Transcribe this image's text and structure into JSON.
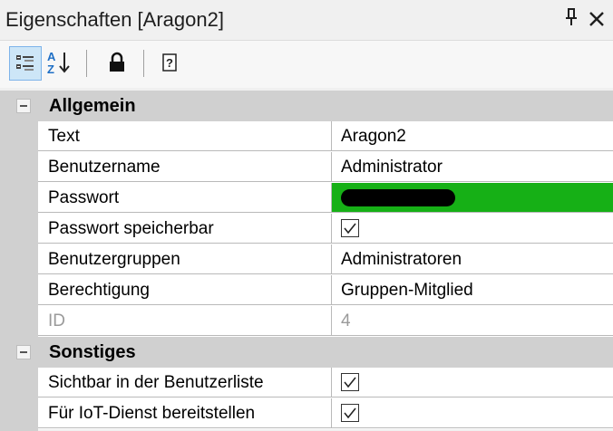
{
  "window": {
    "title": "Eigenschaften [Aragon2]",
    "pin_glyph": "1",
    "close_glyph": "✕"
  },
  "toolbar": {
    "buttons": [
      {
        "name": "categorized",
        "selected": true
      },
      {
        "name": "alphabetical",
        "selected": false
      },
      {
        "name": "lock",
        "selected": false
      },
      {
        "name": "help",
        "selected": false
      }
    ]
  },
  "categories": [
    {
      "label": "Allgemein",
      "properties": [
        {
          "name": "Text",
          "value": "Aragon2"
        },
        {
          "name": "Benutzername",
          "value": "Administrator"
        },
        {
          "name": "Passwort",
          "value": "",
          "masked": true,
          "highlight_color": "#16b016"
        },
        {
          "name": "Passwort speicherbar",
          "value": "",
          "checkbox": true,
          "checked": true
        },
        {
          "name": "Benutzergruppen",
          "value": "Administratoren"
        },
        {
          "name": "Berechtigung",
          "value": "Gruppen-Mitglied"
        },
        {
          "name": "ID",
          "value": "4",
          "disabled": true
        }
      ]
    },
    {
      "label": "Sonstiges",
      "properties": [
        {
          "name": "Sichtbar in der Benutzerliste",
          "value": "",
          "checkbox": true,
          "checked": true
        },
        {
          "name": "Für IoT-Dienst bereitstellen",
          "value": "",
          "checkbox": true,
          "checked": true
        }
      ]
    }
  ],
  "colors": {
    "category_bg": "#d0d0d0",
    "selected_toolbar_bg": "#cde6f7",
    "grid_line": "#b9b9b9"
  }
}
